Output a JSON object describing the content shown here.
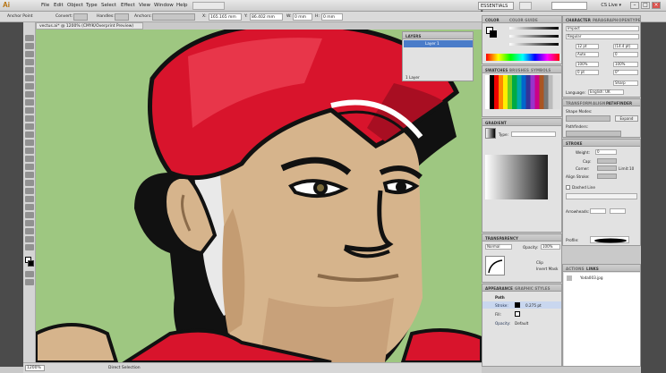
{
  "app": {
    "logo": "Ai",
    "menu": [
      "File",
      "Edit",
      "Object",
      "Type",
      "Select",
      "Effect",
      "View",
      "Window",
      "Help"
    ],
    "workspace": "ESSENTIALS ▾",
    "cs_live": "CS Live ▾",
    "win_minimize": "–",
    "win_maximize": "□",
    "win_close": "×"
  },
  "control_bar": {
    "tool_name": "Anchor Point",
    "convert_label": "Convert:",
    "handles_label": "Handles:",
    "anchors_label": "Anchors:",
    "x_label": "X:",
    "x_value": "165.165 mm",
    "y_label": "Y:",
    "y_value": "86.402 mm",
    "w_label": "W:",
    "w_value": "0 mm",
    "h_label": "H:",
    "h_value": "0 mm"
  },
  "document": {
    "tab_title": "vectus.ai* @ 1200% (CMYK/Overprint Preview)",
    "zoom": "1200%",
    "status_tool": "Direct Selection"
  },
  "layers_panel": {
    "tab": "LAYERS",
    "layer_name": "Layer 1",
    "footer": "1 Layer"
  },
  "color_panel": {
    "tabs": [
      "COLOR",
      "COLOR GUIDE"
    ]
  },
  "swatches_panel": {
    "tabs": [
      "SWATCHES",
      "BRUSHES",
      "SYMBOLS"
    ]
  },
  "gradient_panel": {
    "tab": "GRADIENT",
    "type_label": "Type:"
  },
  "transparency_panel": {
    "tab": "TRANSPARENCY",
    "mode": "Normal",
    "opacity_label": "Opacity:",
    "opacity_value": "100%",
    "clip_label": "Clip",
    "invert_label": "Invert Mask"
  },
  "appearance_panel": {
    "tabs": [
      "APPEARANCE",
      "GRAPHIC STYLES"
    ],
    "object": "Path",
    "stroke_label": "Stroke:",
    "stroke_value": "0.275 pt",
    "fill_label": "Fill:",
    "opacity_label": "Opacity:",
    "opacity_value": "Default"
  },
  "character_panel": {
    "tabs": [
      "CHARACTER",
      "PARAGRAPH",
      "OPENTYPE"
    ],
    "font": "Impact",
    "style": "Regular",
    "size": "12 pt",
    "leading": "(14.4 pt)",
    "kerning": "Auto",
    "tracking": "0",
    "scale_h": "100%",
    "scale_v": "100%",
    "baseline": "0 pt",
    "rotation": "0°",
    "aa": "Sharp",
    "language_label": "Language:",
    "language": "English: UK"
  },
  "transform_panel": {
    "tabs": [
      "TRANSFORM",
      "ALIGN",
      "PATHFINDER"
    ],
    "shape_modes": "Shape Modes:",
    "expand": "Expand",
    "pathfinders": "Pathfinders:"
  },
  "stroke_panel": {
    "tab": "STROKE",
    "weight_label": "Weight:",
    "weight_value": "0",
    "cap_label": "Cap:",
    "corner_label": "Corner:",
    "limit_label": "Limit:",
    "limit_value": "10",
    "align_label": "Align Stroke:",
    "dashed_label": "Dashed Line",
    "arrowheads_label": "Arrowheads:",
    "profile_label": "Profile:"
  },
  "actions_panel": {
    "tabs": [
      "ACTIONS",
      "LINKS"
    ],
    "link_file": "Yoda003.jpg"
  },
  "colors": {
    "canvas_bg": "#9ec781",
    "cap_red": "#d8142c",
    "skin": "#d6b48c",
    "outline": "#111111"
  }
}
